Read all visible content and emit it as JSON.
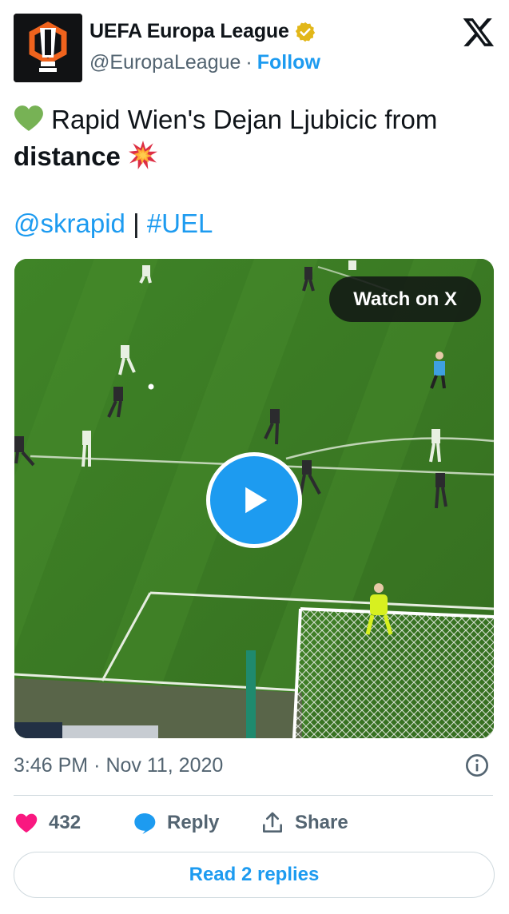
{
  "header": {
    "display_name": "UEFA Europa League",
    "handle": "@EuropaLeague",
    "separator": "·",
    "follow_label": "Follow",
    "verified_icon": "verified-badge-icon",
    "x_logo": "x-logo-icon"
  },
  "tweet": {
    "text_part1": "Rapid Wien's Dejan Ljubicic from",
    "text_bold": "distance",
    "leading_emoji": "green-heart-icon",
    "trailing_emoji": "collision-icon",
    "mention": "@skrapid",
    "pipe": "|",
    "hashtag": "#UEL"
  },
  "media": {
    "type": "video",
    "watch_label": "Watch on X",
    "play_icon": "play-icon",
    "scene": "football-pitch-video-thumbnail"
  },
  "meta": {
    "time": "3:46 PM",
    "separator": "·",
    "date": "Nov 11, 2020",
    "info_icon": "info-icon"
  },
  "actions": {
    "like_count": "432",
    "reply_label": "Reply",
    "share_label": "Share"
  },
  "replies_button": "Read 2 replies",
  "colors": {
    "accent": "#1d9bf0",
    "like": "#f91880",
    "text": "#0f1419",
    "muted": "#536471",
    "border": "#cfd9de",
    "verified_gold": "#e2b719"
  }
}
